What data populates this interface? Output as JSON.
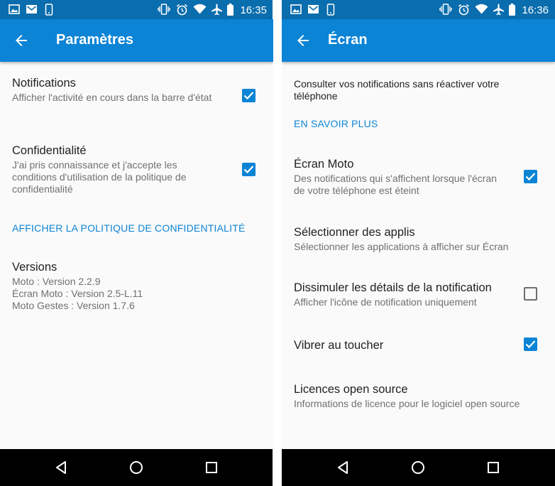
{
  "left": {
    "status_time": "16:35",
    "title": "Paramètres",
    "items": [
      {
        "title": "Notifications",
        "subtitle": "Afficher l'activité en cours dans la barre d'état",
        "checked": true
      },
      {
        "title": "Confidentialité",
        "subtitle": "J'ai pris connaissance et j'accepte les conditions d'utilisation de la politique de confidentialité",
        "checked": true
      }
    ],
    "privacy_link": "AFFICHER LA POLITIQUE DE CONFIDENTIALITÉ",
    "versions": {
      "title": "Versions",
      "lines": [
        "Moto : Version 2.2.9",
        "Écran Moto : Version 2.5-L.11",
        "Moto Gestes : Version 1.7.6"
      ]
    }
  },
  "right": {
    "status_time": "16:36",
    "title": "Écran",
    "intro": "Consulter vos notifications sans réactiver votre téléphone",
    "learn_more": "EN SAVOIR PLUS",
    "items": [
      {
        "title": "Écran Moto",
        "subtitle": "Des notifications qui s'affichent lorsque l'écran de votre téléphone est éteint",
        "checked": true
      },
      {
        "title": "Sélectionner des applis",
        "subtitle": "Sélectionner les applications à afficher sur Écran"
      },
      {
        "title": "Dissimuler les détails de la notification",
        "subtitle": "Afficher l'icône de notification uniquement",
        "checked": false
      },
      {
        "title": "Vibrer au toucher",
        "checked": true
      },
      {
        "title": "Licences open source",
        "subtitle": "Informations de licence pour le logiciel open source"
      }
    ]
  },
  "colors": {
    "status_bar": "#0a6dad",
    "app_bar": "#0c84d6",
    "accent": "#0c84d6",
    "nav_bar": "#000000"
  },
  "icons": [
    "image-icon",
    "mail-icon",
    "phone-icon",
    "vibrate-icon",
    "alarm-icon",
    "wifi-icon",
    "airplane-icon",
    "battery-icon",
    "back-arrow-icon",
    "nav-back-icon",
    "nav-home-icon",
    "nav-recents-icon"
  ]
}
